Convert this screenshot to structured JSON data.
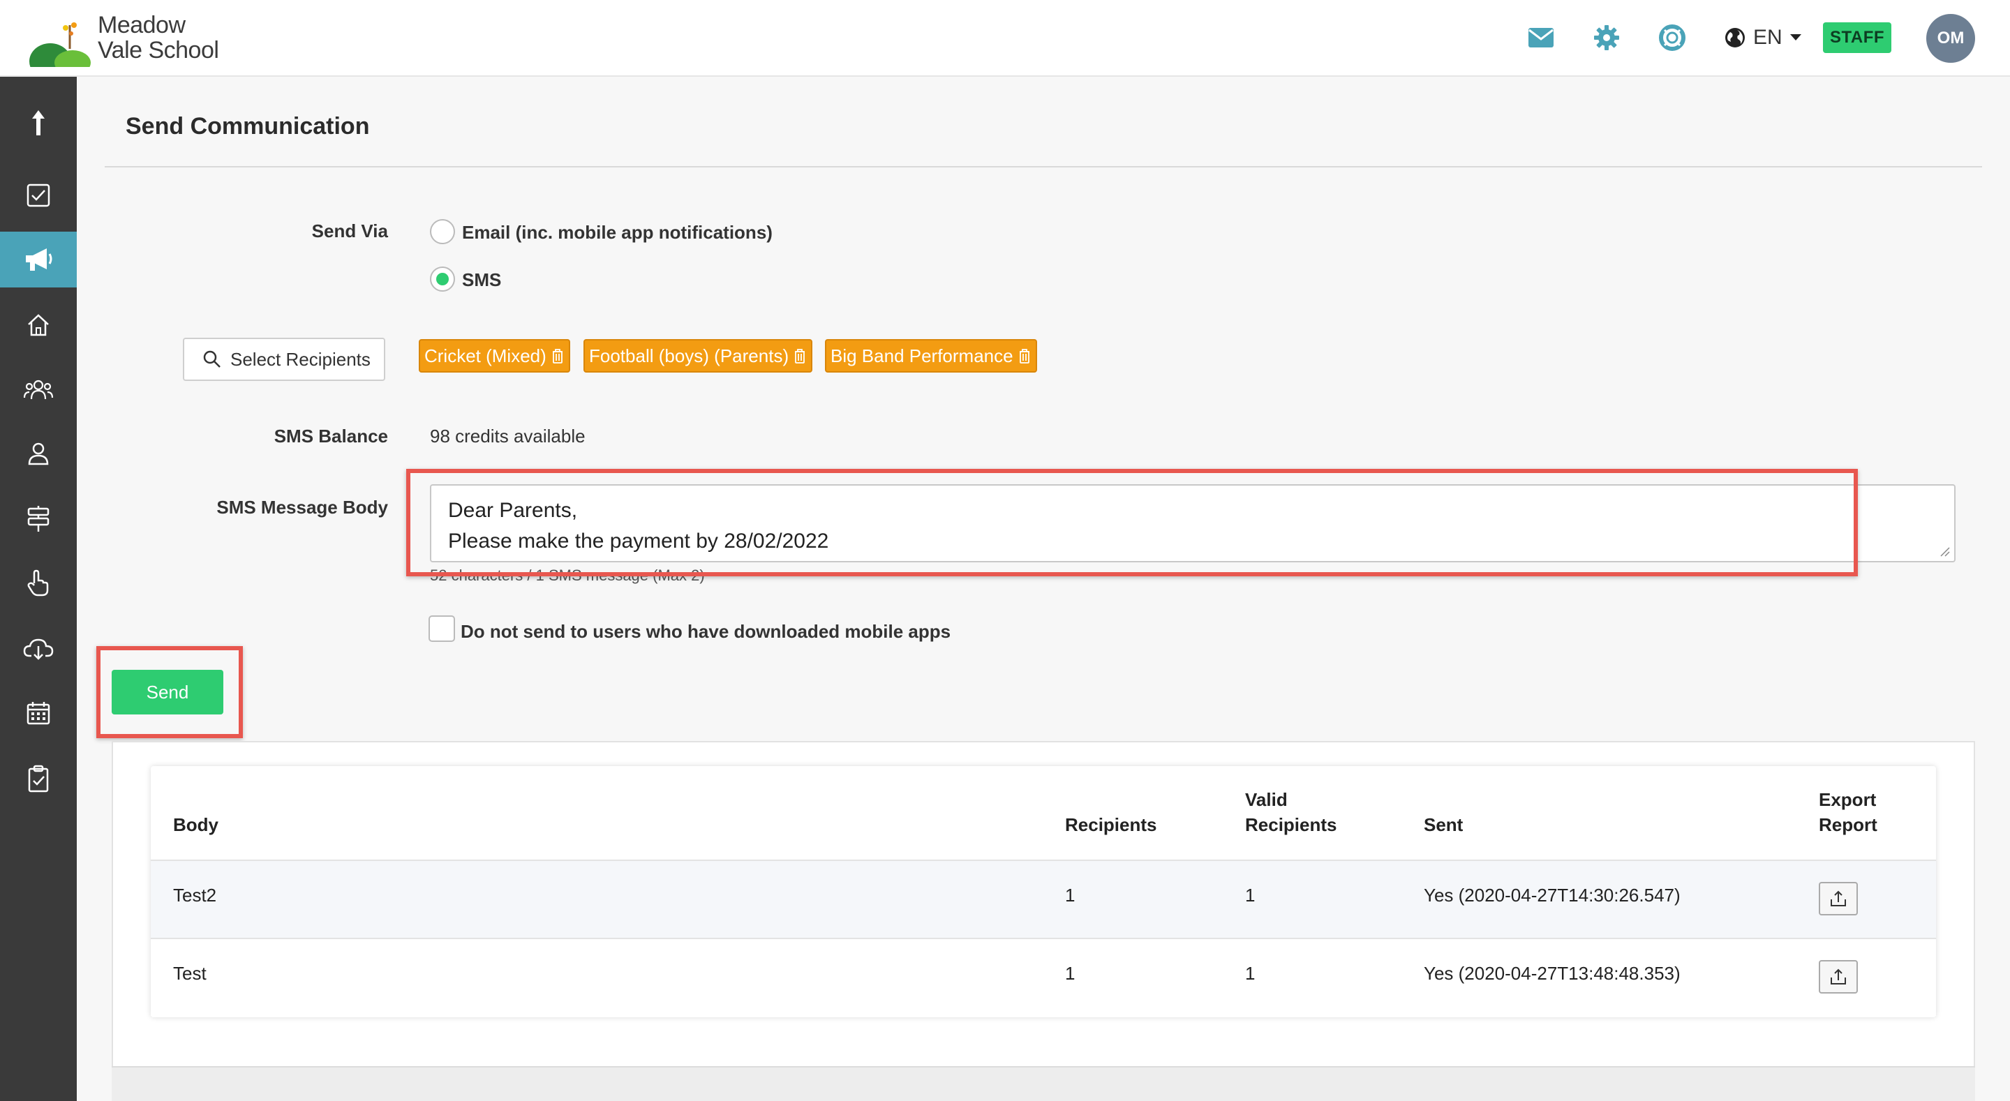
{
  "header": {
    "logo_line1": "Meadow",
    "logo_line2": "Vale School",
    "language": "EN",
    "staff_badge": "STAFF",
    "avatar_initials": "OM"
  },
  "sidebar": {
    "items": [
      {
        "icon": "upload-arrow-icon"
      },
      {
        "icon": "checkbox-icon"
      },
      {
        "icon": "megaphone-icon",
        "active": true
      },
      {
        "icon": "home-icon"
      },
      {
        "icon": "users-group-icon"
      },
      {
        "icon": "user-icon"
      },
      {
        "icon": "signpost-icon"
      },
      {
        "icon": "hand-pointer-icon"
      },
      {
        "icon": "cloud-download-icon"
      },
      {
        "icon": "calendar-icon"
      },
      {
        "icon": "clipboard-check-icon"
      }
    ]
  },
  "page": {
    "title": "Send Communication"
  },
  "form": {
    "send_via_label": "Send Via",
    "option_email": "Email (inc. mobile app notifications)",
    "option_sms": "SMS",
    "selected": "SMS",
    "select_recipients": "Select Recipients",
    "recipients": [
      "Cricket (Mixed)",
      "Football (boys) (Parents)",
      "Big Band Performance"
    ],
    "sms_balance_label": "SMS Balance",
    "sms_balance_value": "98 credits available",
    "sms_body_label": "SMS Message Body",
    "sms_body_line1": "Dear Parents,",
    "sms_body_line2": "Please make the payment by 28/02/2022",
    "counter": "52 characters / 1 SMS message (Max 2)",
    "no_mobile_label": "Do not send to users who have downloaded mobile apps",
    "send_button": "Send"
  },
  "table": {
    "headers": {
      "body": "Body",
      "recipients": "Recipients",
      "valid_recipients_1": "Valid",
      "valid_recipients_2": "Recipients",
      "sent": "Sent",
      "export_1": "Export",
      "export_2": "Report"
    },
    "rows": [
      {
        "body": "Test2",
        "recipients": "1",
        "valid": "1",
        "sent": "Yes (2020-04-27T14:30:26.547)"
      },
      {
        "body": "Test",
        "recipients": "1",
        "valid": "1",
        "sent": "Yes (2020-04-27T13:48:48.353)"
      }
    ]
  },
  "colors": {
    "accent": "#4aa3b8",
    "success": "#2ecc71",
    "chip": "#f39c12",
    "highlight": "#e8574f"
  }
}
